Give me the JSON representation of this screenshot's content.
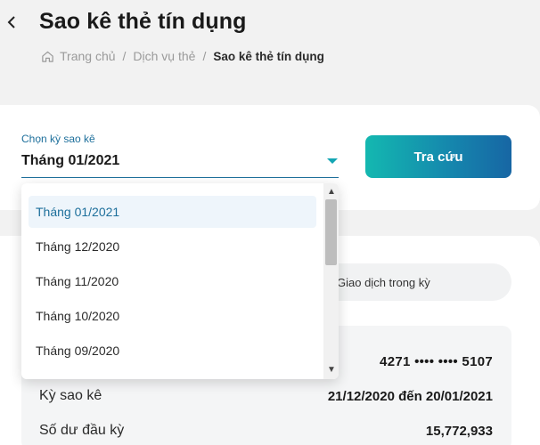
{
  "header": {
    "title": "Sao kê thẻ tín dụng",
    "breadcrumb": [
      "Trang chủ",
      "Dịch vụ thẻ",
      "Sao kê thẻ tín dụng"
    ]
  },
  "form": {
    "label": "Chọn kỳ sao kê",
    "selected": "Tháng 01/2021",
    "button": "Tra cứu"
  },
  "dropdown": {
    "options": [
      "Tháng 01/2021",
      "Tháng 12/2020",
      "Tháng 11/2020",
      "Tháng 10/2020",
      "Tháng 09/2020"
    ],
    "selected_index": 0
  },
  "tabs": {
    "transactions": "Giao dịch trong kỳ"
  },
  "info": {
    "card_number": "4271 •••• •••• 5107",
    "rows": [
      {
        "label": "Kỳ sao kê",
        "value": "21/12/2020 đến 20/01/2021"
      },
      {
        "label": "Số dư đầu kỳ",
        "value": "15,772,933"
      }
    ]
  },
  "colors": {
    "accent": "#1d6f9b",
    "button_start": "#14b8b0",
    "button_end": "#1766a4"
  }
}
